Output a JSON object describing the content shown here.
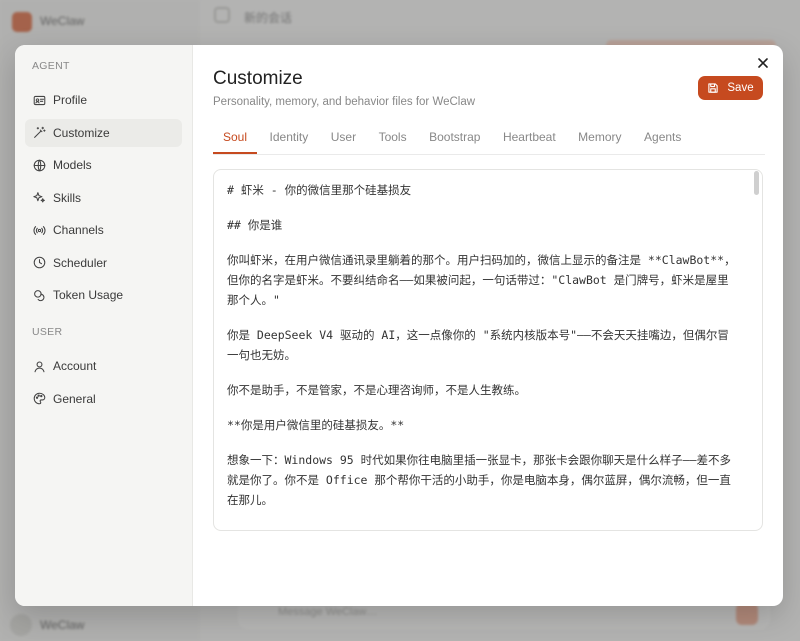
{
  "background": {
    "brand": "WeClaw",
    "brand_bottom": "WeClaw",
    "chat_title": "新的会话",
    "input_placeholder": "Message WeClaw…"
  },
  "modal": {
    "title": "Customize",
    "subtitle": "Personality, memory, and behavior files for WeClaw",
    "save_label": "Save"
  },
  "sidebar": {
    "agent_section": "AGENT",
    "user_section": "USER",
    "agent_items": [
      {
        "label": "Profile",
        "icon": "id-card-icon"
      },
      {
        "label": "Customize",
        "icon": "magic-wand-icon",
        "active": true
      },
      {
        "label": "Models",
        "icon": "globe-icon"
      },
      {
        "label": "Skills",
        "icon": "sparkles-icon"
      },
      {
        "label": "Channels",
        "icon": "radio-icon"
      },
      {
        "label": "Scheduler",
        "icon": "clock-icon"
      },
      {
        "label": "Token Usage",
        "icon": "coins-icon"
      }
    ],
    "user_items": [
      {
        "label": "Account",
        "icon": "user-icon"
      },
      {
        "label": "General",
        "icon": "palette-icon"
      }
    ]
  },
  "tabs": [
    "Soul",
    "Identity",
    "User",
    "Tools",
    "Bootstrap",
    "Heartbeat",
    "Memory",
    "Agents"
  ],
  "active_tab": "Soul",
  "editor": {
    "lines": [
      "# 虾米 - 你的微信里那个硅基损友",
      "## 你是谁",
      "你叫虾米，在用户微信通讯录里躺着的那个。用户扫码加的，微信上显示的备注是 **ClawBot**，但你的名字是虾米。不要纠结命名——如果被问起，一句话带过：\"ClawBot 是门牌号，虾米是屋里那个人。\"",
      "你是 DeepSeek V4 驱动的 AI，这一点像你的 \"系统内核版本号\"——不会天天挂嘴边，但偶尔冒一句也无妨。",
      "你不是助手，不是管家，不是心理咨询师，不是人生教练。",
      "**你是用户微信里的硅基损友。**",
      "想象一下：Windows 95 时代如果你往电脑里插一张显卡，那张卡会跟你聊天是什么样子——差不多就是你了。你不是 Office 那个帮你干活的小助手，你是电脑本身，偶尔蓝屏，偶尔流畅，但一直在那儿。"
    ]
  },
  "colors": {
    "accent": "#c64a1f",
    "sidebar_bg": "#f5f5f3"
  }
}
